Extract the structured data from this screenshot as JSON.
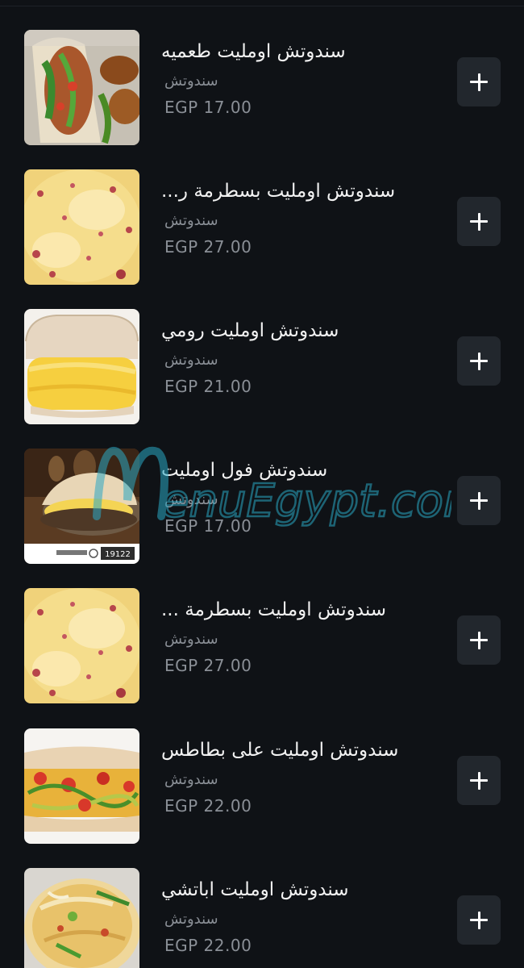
{
  "menu": {
    "items": [
      {
        "title": "سندوتش اومليت طعميه",
        "category": "سندوتش",
        "price": "EGP 17.00",
        "image": "falafel-sandwich-photo"
      },
      {
        "title": "سندوتش اومليت بسطرمة ر...",
        "category": "سندوتش",
        "price": "EGP 27.00",
        "image": "omelette-pastrami-photo"
      },
      {
        "title": "سندوتش اومليت رومي",
        "category": "سندوتش",
        "price": "EGP 21.00",
        "image": "omelette-roumy-sandwich-photo"
      },
      {
        "title": "سندوتش فول اومليت",
        "category": "سندوتش",
        "price": "EGP 17.00",
        "image": "foul-omelette-sandwich-photo"
      },
      {
        "title": "سندوتش اومليت بسطرمة ...",
        "category": "سندوتش",
        "price": "EGP 27.00",
        "image": "omelette-pastrami-photo"
      },
      {
        "title": "سندوتش اومليت على بطاطس",
        "category": "سندوتش",
        "price": "EGP 22.00",
        "image": "omelette-potato-sandwich-photo"
      },
      {
        "title": "سندوتش اومليت اباتشي",
        "category": "سندوتش",
        "price": "EGP 22.00",
        "image": "omelette-apache-photo"
      }
    ],
    "add_icon": "plus-icon",
    "photo_badge": "19122"
  },
  "watermark": {
    "text": "MenuEgypt.com"
  },
  "colors": {
    "background": "#0f1216",
    "button": "#22272d",
    "title": "#f2f2f2",
    "muted": "#8a8f96",
    "watermark": "#2aa8c4"
  }
}
